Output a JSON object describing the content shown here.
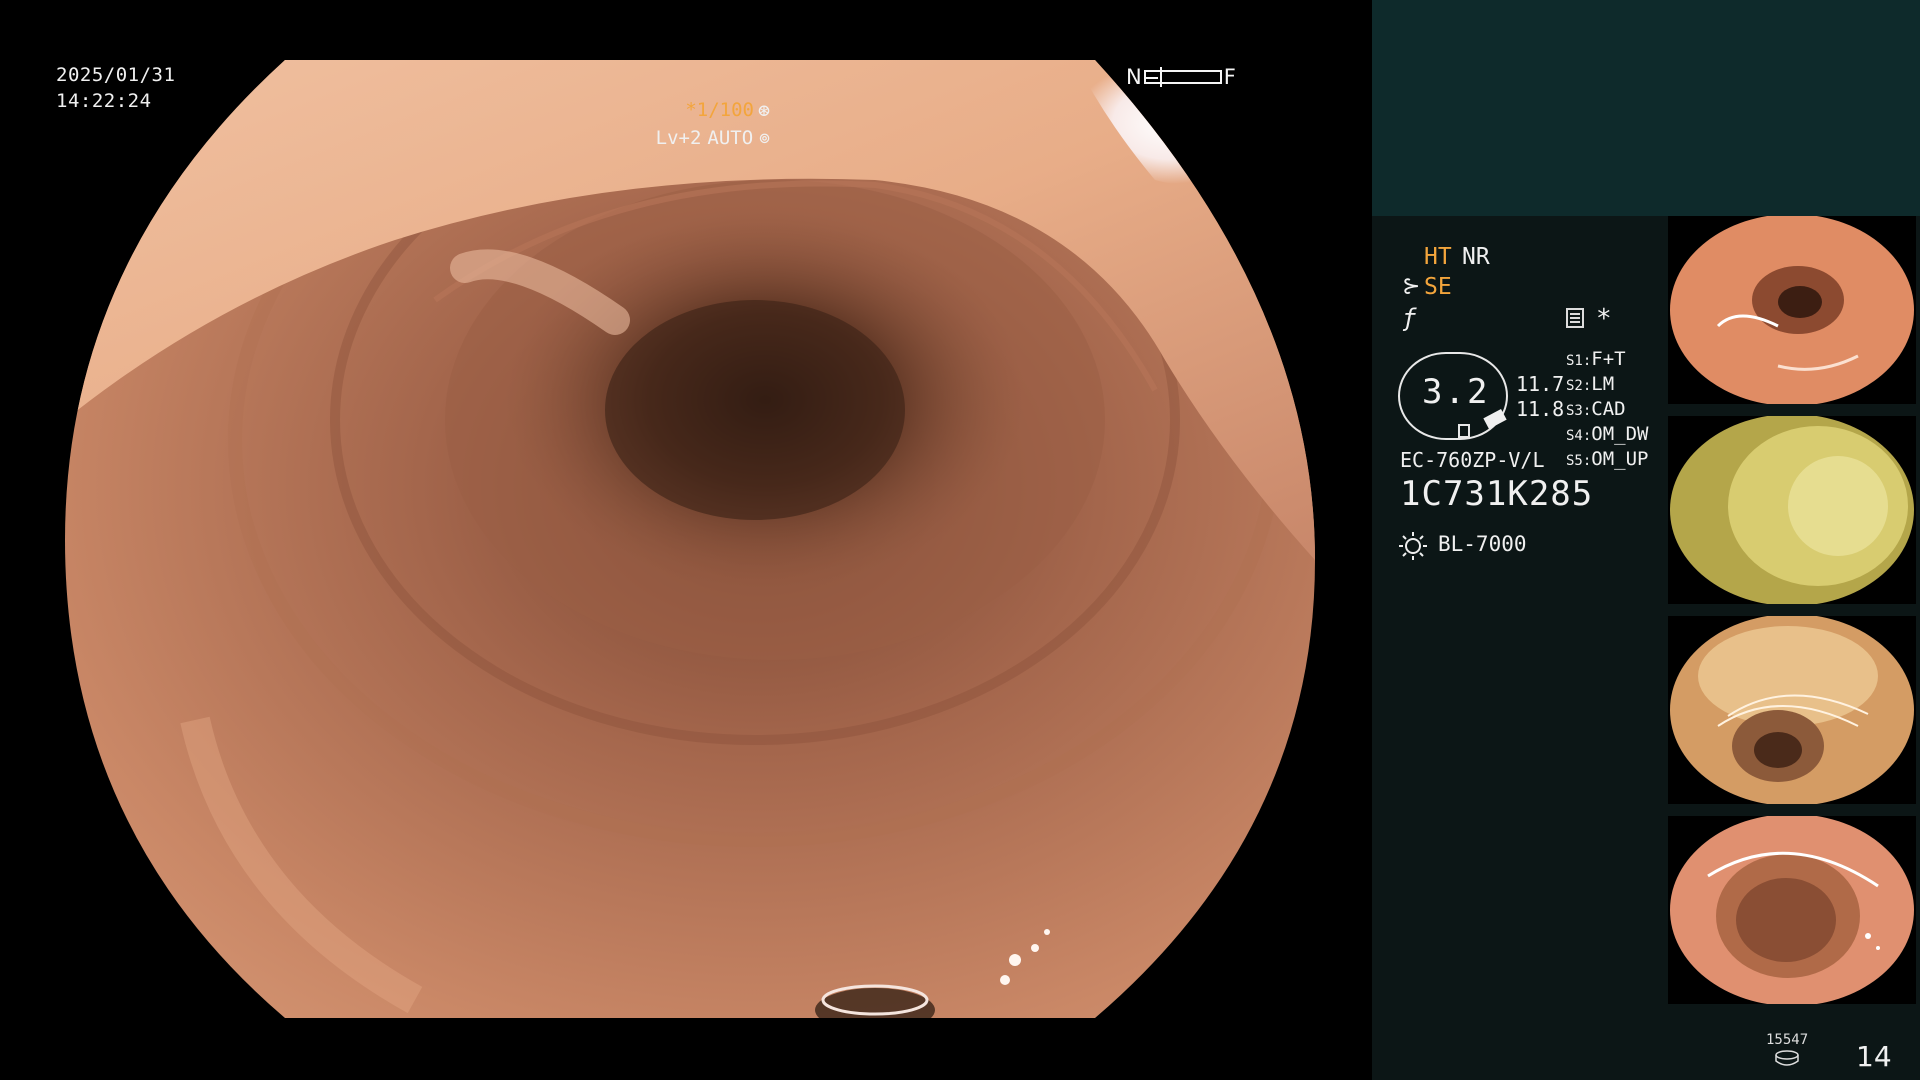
{
  "osd": {
    "date": "2025/01/31",
    "time": "14:22:24",
    "near_label": "N",
    "far_label": "F",
    "shutter": "*1/100",
    "shutter_icon": "aperture-icon",
    "level": "Lv+2",
    "mode": "AUTO",
    "mode_icon": "auto-iris-icon"
  },
  "panel": {
    "ht": "HT",
    "nr": "NR",
    "se": "SE",
    "star": "*",
    "zoom_value": "3.2",
    "zoom_side_1": "11.7",
    "zoom_side_2": "11.8",
    "settings": [
      {
        "key": "S1:",
        "value": "F+T"
      },
      {
        "key": "S2:",
        "value": "LM"
      },
      {
        "key": "S3:",
        "value": "CAD"
      },
      {
        "key": "S4:",
        "value": "OM_DW"
      },
      {
        "key": "S5:",
        "value": "OM_UP"
      }
    ],
    "scope_model": "EC-760ZP-V/L",
    "scope_serial": "1C731K285",
    "light_source": "BL-7000",
    "image_count_small": "15547",
    "image_count": "14"
  },
  "colors": {
    "accent_orange": "#f3a53c",
    "panel_bg": "#0c1616",
    "panel_top": "#0e2a2b"
  }
}
